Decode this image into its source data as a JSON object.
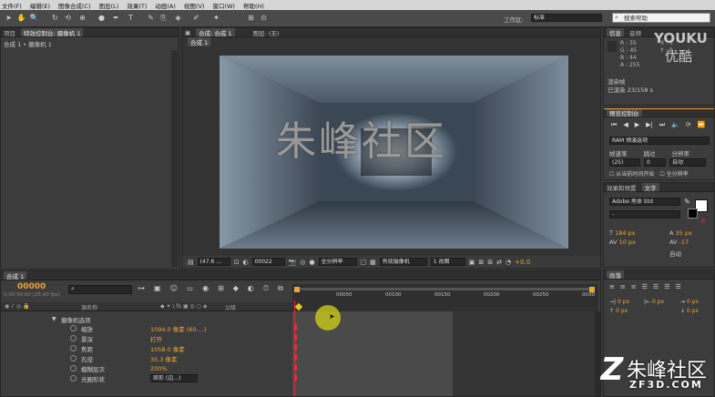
{
  "menu": [
    "文件(F)",
    "编辑(E)",
    "图像合成(C)",
    "图层(L)",
    "效果(T)",
    "动画(A)",
    "视图(V)",
    "窗口(W)",
    "帮助(H)"
  ],
  "toolbar": {
    "workspace_label": "工作区:",
    "workspace_value": "标准",
    "search_placeholder": "搜索帮助"
  },
  "project": {
    "tab": "项目",
    "fx_tab": "特效控制台: 摄像机 1",
    "breadcrumb": "合成 1 • 摄像机 1"
  },
  "comp": {
    "tab": "合成: 合成 1",
    "layer_tab": "图层: (无)",
    "subtab": "合成 1",
    "overlay_text": "朱峰社区",
    "zoom": "(47.6 ...",
    "timecode": "00022",
    "resolution": "全分辨率",
    "camera": "有效摄像机",
    "views": "1 视图",
    "exposure": "+0.0"
  },
  "info": {
    "tab": "信息",
    "audio_tab": "音频",
    "r": "R : 35",
    "g": "G : 45",
    "b": "B : 44",
    "a": "A : 255",
    "x": "X : 5",
    "y": "Y : 3",
    "status1": "渲染帧",
    "status2": "已渲染 23/158 s"
  },
  "preview": {
    "tab": "预览控制台",
    "ram": "RAM 预演选项",
    "frame_rate_label": "帧速率",
    "skip_label": "跳过",
    "res_label": "分辨率",
    "frame_rate": "(25)",
    "skip": "0",
    "res": "自动",
    "from_current": "从当前时间开始",
    "full_screen": "全分辨率"
  },
  "effects": {
    "tab1": "效果和预置",
    "tab2": "文字",
    "font": "Adobe 黑体 Std",
    "style": "-",
    "size": "184 px",
    "leading": "35 px",
    "tracking": "-17",
    "kerning": "10 px",
    "auto_label": "自动"
  },
  "paragraph": {
    "tab": "段落",
    "px1": "0 px",
    "px2": "0 px",
    "px3": "0 px",
    "px4": "0 px",
    "px5": "0 px"
  },
  "timeline": {
    "tab": "合成 1",
    "timecode": "00000",
    "fps": "0:00:00:00 (25.00 fps)",
    "col_name": "源名称",
    "col_mode": "父级",
    "search_placeholder": "",
    "ticks": [
      "00050",
      "00100",
      "00150",
      "00200",
      "00250",
      "0030"
    ],
    "rows": [
      {
        "label": "摄像机选项",
        "value": ""
      },
      {
        "label": "缩放",
        "value": "1094.0 像素 (60....)"
      },
      {
        "label": "景深",
        "value": "打开"
      },
      {
        "label": "焦距",
        "value": "1058.0 像素"
      },
      {
        "label": "孔径",
        "value": "35.3 像素"
      },
      {
        "label": "模糊层次",
        "value": "200%"
      },
      {
        "label": "光圈形状",
        "value": "矩形 (边...)"
      }
    ]
  },
  "watermark": {
    "youku": "YOUKU",
    "youku_sub": "优酷",
    "brand": "朱峰社区",
    "url": "ZF3D.COM"
  }
}
